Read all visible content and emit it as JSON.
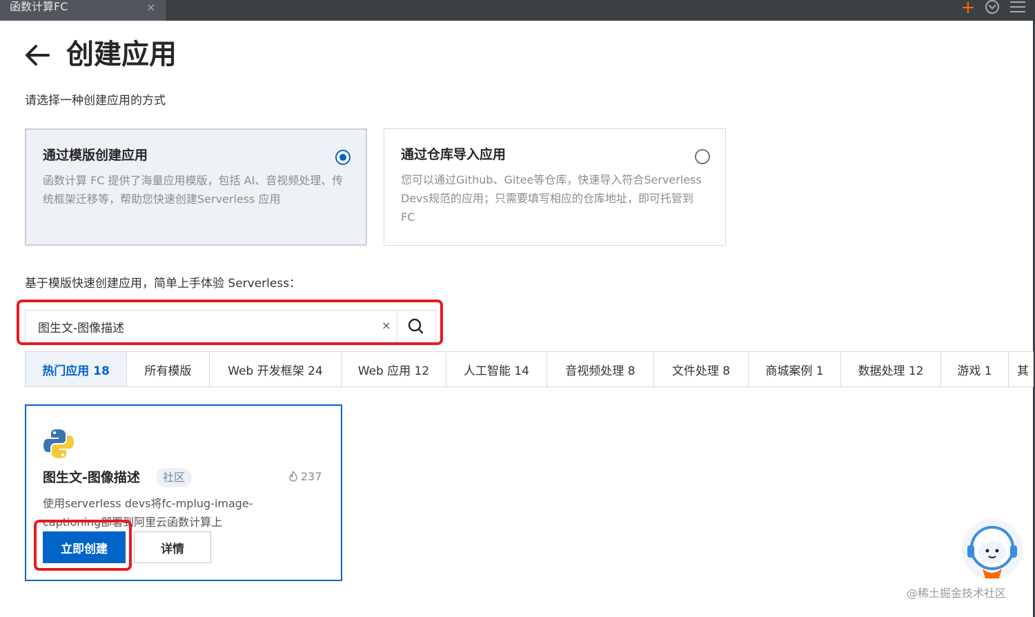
{
  "window": {
    "tab_title": "函数计算FC",
    "tab_close": "×"
  },
  "header": {
    "title": "创建应用",
    "subtitle": "请选择一种创建应用的方式"
  },
  "methods": [
    {
      "title": "通过模版创建应用",
      "description": "函数计算 FC 提供了海量应用模版，包括 AI、音视频处理、传统框架迁移等，帮助您快速创建Serverless 应用",
      "selected": true
    },
    {
      "title": "通过仓库导入应用",
      "description": "您可以通过Github、Gitee等仓库，快速导入符合Serverless Devs规范的应用；只需要填写相应的仓库地址，即可托管到 FC",
      "selected": false
    }
  ],
  "templates": {
    "hint": "基于模版快速创建应用，简单上手体验 Serverless：",
    "search_value": "图生文-图像描述",
    "clear_label": "×",
    "tabs": [
      "热门应用 18",
      "所有模版",
      "Web 开发框架 24",
      "Web 应用 12",
      "人工智能 14",
      "音视频处理 8",
      "文件处理 8",
      "商城案例 1",
      "数据处理 12",
      "游戏 1",
      "其"
    ],
    "active_tab": 0,
    "card": {
      "icon": "python-icon",
      "title": "图生文-图像描述",
      "badge": "社区",
      "hot_count": "237",
      "description": "使用serverless devs将fc-mplug-image-captioning部署到阿里云函数计算上",
      "create_label": "立即创建",
      "detail_label": "详情"
    }
  },
  "watermark": "@稀土掘金技术社区",
  "colors": {
    "primary": "#0064c8",
    "highlight": "#e8191e",
    "chrome": "#3c3f44",
    "accent": "#ff6a00"
  }
}
